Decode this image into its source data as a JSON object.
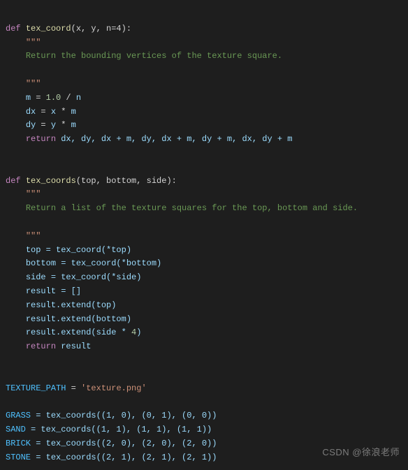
{
  "code": {
    "fn1": {
      "kw_def": "def",
      "name": "tex_coord",
      "params": "(x, y, n=4):",
      "docq1": "\"\"\"",
      "doc_line": "Return the bounding vertices of the texture square.",
      "docq2": "\"\"\"",
      "l1_lhs": "m",
      "l1_eq": " = ",
      "l1_n1": "1.0",
      "l1_div": " / ",
      "l1_rhs": "n",
      "l2_lhs": "dx",
      "l2_eq": " = ",
      "l2_a": "x",
      "l2_mul": " * ",
      "l2_b": "m",
      "l3_lhs": "dy",
      "l3_eq": " = ",
      "l3_a": "y",
      "l3_mul": " * ",
      "l3_b": "m",
      "kw_return": "return",
      "ret": " dx, dy, dx + m, dy, dx + m, dy + m, dx, dy + m"
    },
    "fn2": {
      "kw_def": "def",
      "name": "tex_coords",
      "params": "(top, bottom, side):",
      "docq1": "\"\"\"",
      "doc_line": "Return a list of the texture squares for the top, bottom and side.",
      "docq2": "\"\"\"",
      "l1": "top = tex_coord(*top)",
      "l2": "bottom = tex_coord(*bottom)",
      "l3": "side = tex_coord(*side)",
      "l4": "result = []",
      "l5": "result.extend(top)",
      "l6": "result.extend(bottom)",
      "l7_a": "result.extend(side * ",
      "l7_num": "4",
      "l7_b": ")",
      "kw_return": "return",
      "ret": " result"
    },
    "tex_path_lhs": "TEXTURE_PATH",
    "tex_path_eq": " = ",
    "tex_path_val": "'texture.png'",
    "assigns": {
      "grass": {
        "name": "GRASS",
        "rhs": " = tex_coords((1, 0), (0, 1), (0, 0))"
      },
      "sand": {
        "name": "SAND",
        "rhs": " = tex_coords((1, 1), (1, 1), (1, 1))"
      },
      "brick": {
        "name": "BRICK",
        "rhs": " = tex_coords((2, 0), (2, 0), (2, 0))"
      },
      "stone": {
        "name": "STONE",
        "rhs": " = tex_coords((2, 1), (2, 1), (2, 1))"
      }
    }
  },
  "watermark": "CSDN @徐浪老师"
}
